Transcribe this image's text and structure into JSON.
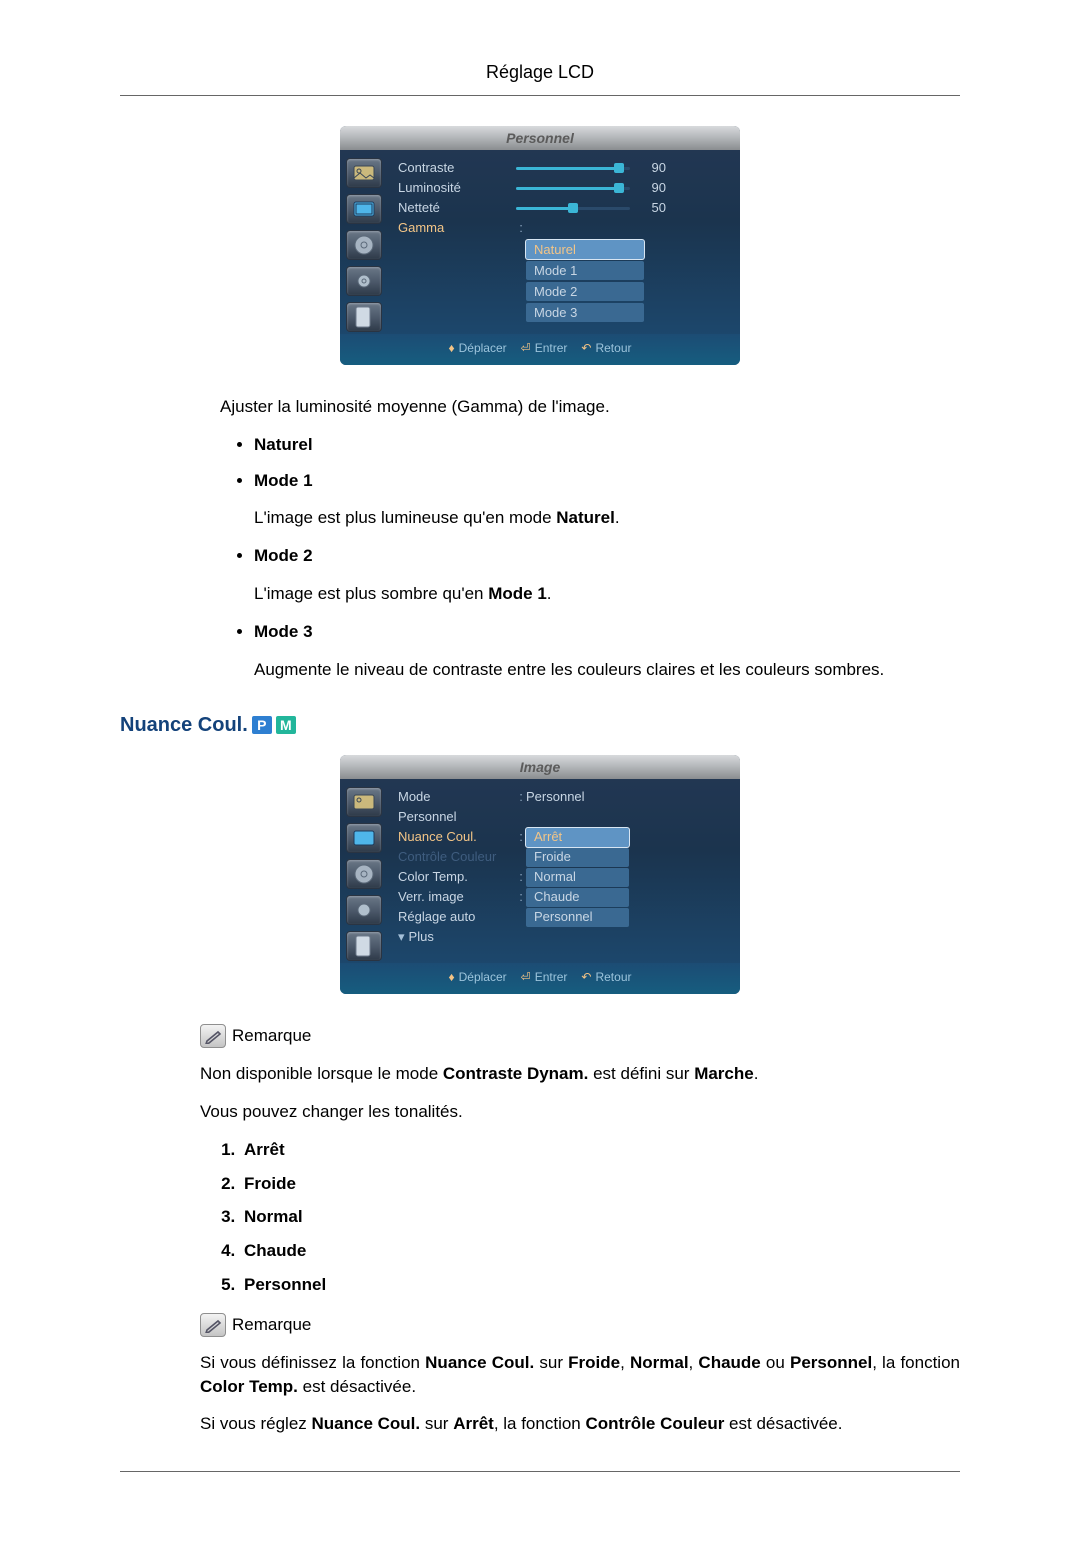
{
  "doc_title": "Réglage LCD",
  "osd1": {
    "title": "Personnel",
    "rows": {
      "contraste": "Contraste",
      "luminosite": "Luminosité",
      "nettete": "Netteté",
      "gamma": "Gamma"
    },
    "values": {
      "contraste": 90,
      "luminosite": 90,
      "nettete": 50
    },
    "gamma_options": [
      "Naturel",
      "Mode 1",
      "Mode 2",
      "Mode 3"
    ],
    "footer": {
      "move": "Déplacer",
      "enter": "Entrer",
      "return": "Retour"
    }
  },
  "gamma_intro": "Ajuster la luminosité moyenne (Gamma) de l'image.",
  "gamma_modes": {
    "naturel": "Naturel",
    "mode1": "Mode 1",
    "mode1_desc_pre": "L'image est plus lumineuse qu'en mode ",
    "mode1_desc_bold": "Naturel",
    "mode2": "Mode 2",
    "mode2_desc_pre": "L'image est plus sombre qu'en ",
    "mode2_desc_bold": "Mode 1",
    "mode3": "Mode 3",
    "mode3_desc": "Augmente le niveau de contraste entre les couleurs claires et les couleurs sombres."
  },
  "section_title": "Nuance Coul.",
  "badges": {
    "p": "P",
    "m": "M"
  },
  "osd2": {
    "title": "Image",
    "items": {
      "mode": "Mode",
      "mode_val": "Personnel",
      "personnel": "Personnel",
      "nuance": "Nuance Coul.",
      "controle": "Contrôle Couleur",
      "colortemp": "Color Temp.",
      "verr": "Verr. image",
      "reglage": "Réglage auto",
      "plus": "Plus"
    },
    "options": [
      "Arrêt",
      "Froide",
      "Normal",
      "Chaude",
      "Personnel"
    ],
    "footer": {
      "move": "Déplacer",
      "enter": "Entrer",
      "return": "Retour"
    }
  },
  "remark_label": "Remarque",
  "note1_pre": "Non disponible lorsque le mode ",
  "note1_b1": "Contraste Dynam.",
  "note1_mid": " est défini sur ",
  "note1_b2": "Marche",
  "note1_end": ".",
  "note2": "Vous pouvez changer les tonalités.",
  "tone_list": [
    "Arrêt",
    "Froide",
    "Normal",
    "Chaude",
    "Personnel"
  ],
  "note3": {
    "a": "Si vous définissez la fonction ",
    "b": "Nuance Coul.",
    "c": " sur ",
    "d": "Froide",
    "e": ", ",
    "f": "Normal",
    "g": ", ",
    "h": "Chaude",
    "i": " ou ",
    "j": "Personnel",
    "k": ", la fonction ",
    "l": "Color Temp.",
    "m": " est désactivée."
  },
  "note4": {
    "a": "Si vous réglez ",
    "b": "Nuance Coul.",
    "c": " sur ",
    "d": "Arrêt",
    "e": ", la fonction ",
    "f": "Contrôle Couleur",
    "g": " est désactivée."
  }
}
